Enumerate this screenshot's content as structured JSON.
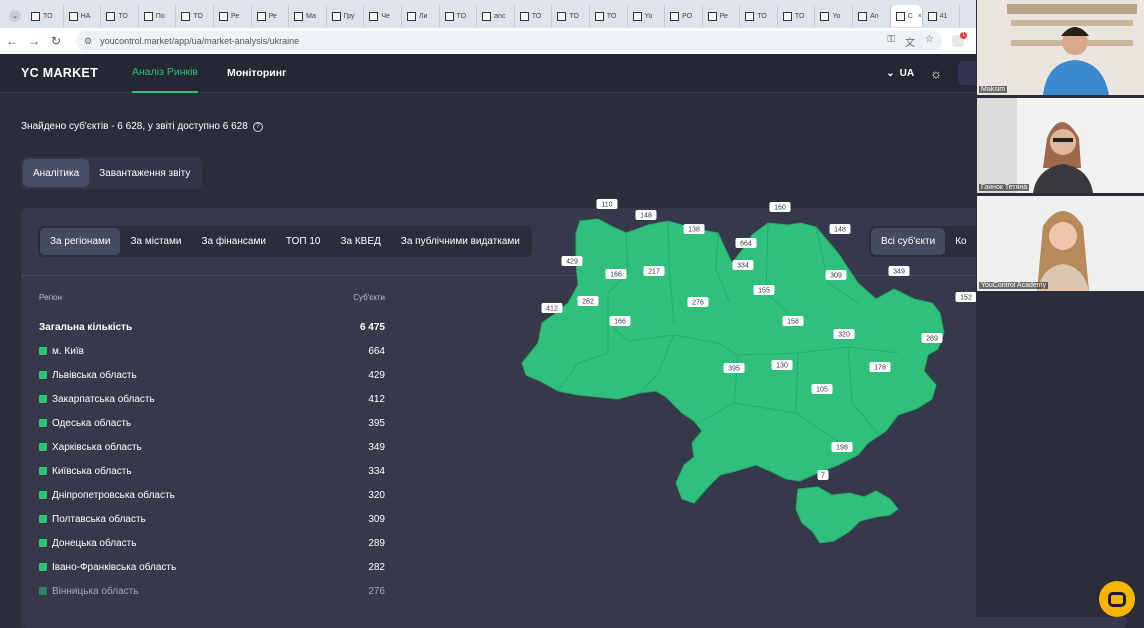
{
  "browser": {
    "tabs": [
      {
        "label": "TO"
      },
      {
        "label": "НА"
      },
      {
        "label": "TO"
      },
      {
        "label": "По"
      },
      {
        "label": "TO"
      },
      {
        "label": "Ре"
      },
      {
        "label": "Ре"
      },
      {
        "label": "Ma"
      },
      {
        "label": "Гру"
      },
      {
        "label": "Че"
      },
      {
        "label": "Ли"
      },
      {
        "label": "TO"
      },
      {
        "label": "anc"
      },
      {
        "label": "TO"
      },
      {
        "label": "TO"
      },
      {
        "label": "TO"
      },
      {
        "label": "Yo"
      },
      {
        "label": "PO"
      },
      {
        "label": "Ре"
      },
      {
        "label": "TO"
      },
      {
        "label": "TO"
      },
      {
        "label": "Yo"
      },
      {
        "label": "An"
      },
      {
        "label": "C"
      },
      {
        "label": "41"
      }
    ],
    "url": "youcontrol.market/app/ua/market-analysis/ukraine",
    "ext_badge": "1"
  },
  "header": {
    "logo": "YC MARKET",
    "nav": [
      "Аналіз Ринків",
      "Моніторинг"
    ],
    "lang": "UA"
  },
  "summary": {
    "found": "Знайдено суб'єктів - 6 628, у звіті доступно 6 628"
  },
  "tabs": [
    "Аналітика",
    "Завантаження звіту"
  ],
  "filters": [
    "За регіонами",
    "За містами",
    "За фінансами",
    "ТОП 10",
    "За КВЕД",
    "За публічними видатками"
  ],
  "filters_right": [
    "Всі суб'єкти",
    "Ко"
  ],
  "table": {
    "col_region": "Регіон",
    "col_count": "Суб'єкти",
    "total_label": "Загальна кількість",
    "total_value": "6 475",
    "rows": [
      {
        "region": "м. Київ",
        "count": "664"
      },
      {
        "region": "Львівська область",
        "count": "429"
      },
      {
        "region": "Закарпатська область",
        "count": "412"
      },
      {
        "region": "Одеська область",
        "count": "395"
      },
      {
        "region": "Харківська область",
        "count": "349"
      },
      {
        "region": "Київська область",
        "count": "334"
      },
      {
        "region": "Дніпропетровська область",
        "count": "320"
      },
      {
        "region": "Полтавська область",
        "count": "309"
      },
      {
        "region": "Донецька область",
        "count": "289"
      },
      {
        "region": "Івано-Франківська область",
        "count": "282"
      },
      {
        "region": "Вінницька область",
        "count": "276"
      }
    ]
  },
  "map_labels": [
    "110",
    "148",
    "138",
    "160",
    "148",
    "664",
    "334",
    "429",
    "166",
    "217",
    "309",
    "349",
    "412",
    "282",
    "155",
    "152",
    "166",
    "276",
    "158",
    "320",
    "289",
    "395",
    "130",
    "178",
    "105",
    "198",
    "7"
  ],
  "participants": [
    "Maksim",
    "Гаянок Тетяна",
    "YouControl Academy"
  ],
  "colors": {
    "accent": "#29c27a",
    "map_fill": "#2fc07b",
    "bg": "#2b2d3a",
    "panel": "#363949"
  }
}
